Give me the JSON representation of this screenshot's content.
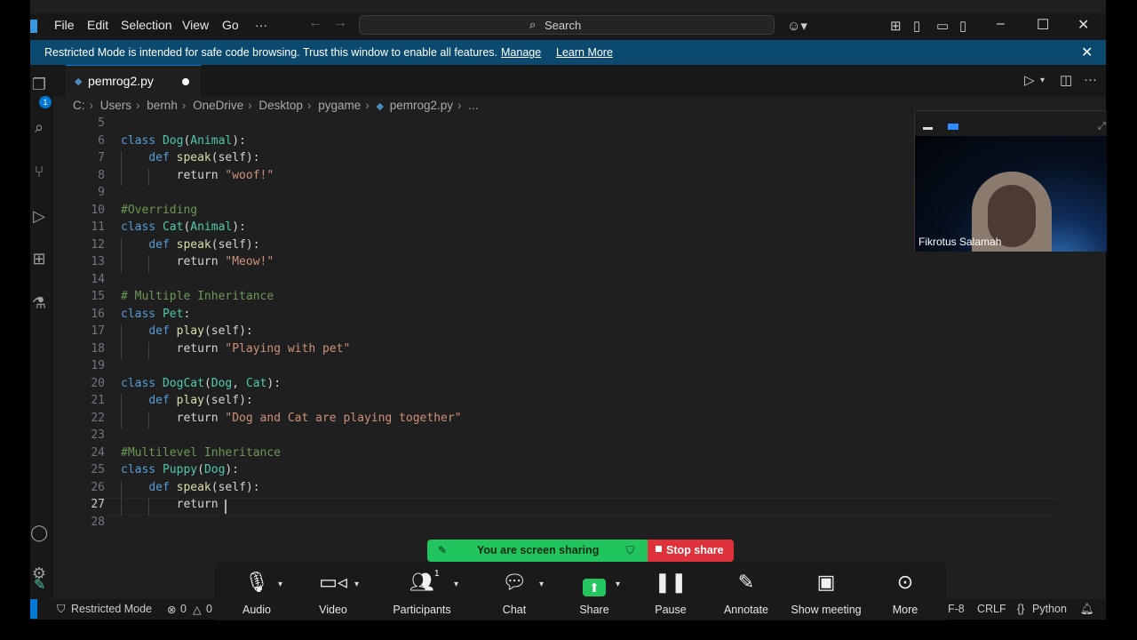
{
  "menu": [
    "File",
    "Edit",
    "Selection",
    "View",
    "Go",
    "···"
  ],
  "search": {
    "label": "Search"
  },
  "banner": {
    "message": "Restricted Mode is intended for safe code browsing. Trust this window to enable all features.",
    "manage": "Manage",
    "learn_more": "Learn More"
  },
  "activity": {
    "explorer_badge": "1"
  },
  "tab": {
    "filename": "pemrog2.py"
  },
  "breadcrumb": [
    "C:",
    "Users",
    "bernh",
    "OneDrive",
    "Desktop",
    "pygame",
    "pemrog2.py",
    "..."
  ],
  "code_lines": [
    {
      "n": "5"
    },
    {
      "n": "6",
      "t": [
        {
          "k": "kw",
          "v": "class "
        },
        {
          "k": "cls",
          "v": "Dog"
        },
        {
          "k": "txt",
          "v": "("
        },
        {
          "k": "cls",
          "v": "Animal"
        },
        {
          "k": "txt",
          "v": "):"
        }
      ]
    },
    {
      "n": "7",
      "t": [
        {
          "k": "txt",
          "v": "    "
        },
        {
          "k": "kw",
          "v": "def "
        },
        {
          "k": "fn",
          "v": "speak"
        },
        {
          "k": "txt",
          "v": "(self):"
        }
      ]
    },
    {
      "n": "8",
      "t": [
        {
          "k": "txt",
          "v": "        return "
        },
        {
          "k": "str",
          "v": "\"woof!\""
        }
      ]
    },
    {
      "n": "9"
    },
    {
      "n": "10",
      "t": [
        {
          "k": "cmt",
          "v": "#Overriding"
        }
      ]
    },
    {
      "n": "11",
      "t": [
        {
          "k": "kw",
          "v": "class "
        },
        {
          "k": "cls",
          "v": "Cat"
        },
        {
          "k": "txt",
          "v": "("
        },
        {
          "k": "cls",
          "v": "Animal"
        },
        {
          "k": "txt",
          "v": "):"
        }
      ]
    },
    {
      "n": "12",
      "t": [
        {
          "k": "txt",
          "v": "    "
        },
        {
          "k": "kw",
          "v": "def "
        },
        {
          "k": "fn",
          "v": "speak"
        },
        {
          "k": "txt",
          "v": "(self):"
        }
      ]
    },
    {
      "n": "13",
      "t": [
        {
          "k": "txt",
          "v": "        return "
        },
        {
          "k": "str",
          "v": "\"Meow!\""
        }
      ]
    },
    {
      "n": "14"
    },
    {
      "n": "15",
      "t": [
        {
          "k": "cmt",
          "v": "# Multiple Inheritance"
        }
      ]
    },
    {
      "n": "16",
      "t": [
        {
          "k": "kw",
          "v": "class "
        },
        {
          "k": "cls",
          "v": "Pet"
        },
        {
          "k": "txt",
          "v": ":"
        }
      ]
    },
    {
      "n": "17",
      "t": [
        {
          "k": "txt",
          "v": "    "
        },
        {
          "k": "kw",
          "v": "def "
        },
        {
          "k": "fn",
          "v": "play"
        },
        {
          "k": "txt",
          "v": "(self):"
        }
      ]
    },
    {
      "n": "18",
      "t": [
        {
          "k": "txt",
          "v": "        return "
        },
        {
          "k": "str",
          "v": "\"Playing with pet\""
        }
      ]
    },
    {
      "n": "19"
    },
    {
      "n": "20",
      "t": [
        {
          "k": "kw",
          "v": "class "
        },
        {
          "k": "cls",
          "v": "DogCat"
        },
        {
          "k": "txt",
          "v": "("
        },
        {
          "k": "cls",
          "v": "Dog"
        },
        {
          "k": "txt",
          "v": ", "
        },
        {
          "k": "cls",
          "v": "Cat"
        },
        {
          "k": "txt",
          "v": "):"
        }
      ]
    },
    {
      "n": "21",
      "t": [
        {
          "k": "txt",
          "v": "    "
        },
        {
          "k": "kw",
          "v": "def "
        },
        {
          "k": "fn",
          "v": "play"
        },
        {
          "k": "txt",
          "v": "(self):"
        }
      ]
    },
    {
      "n": "22",
      "t": [
        {
          "k": "txt",
          "v": "        return "
        },
        {
          "k": "str",
          "v": "\"Dog and Cat are playing together\""
        }
      ]
    },
    {
      "n": "23"
    },
    {
      "n": "24",
      "t": [
        {
          "k": "cmt",
          "v": "#Multilevel Inheritance"
        }
      ]
    },
    {
      "n": "25",
      "t": [
        {
          "k": "kw",
          "v": "class "
        },
        {
          "k": "cls",
          "v": "Puppy"
        },
        {
          "k": "txt",
          "v": "("
        },
        {
          "k": "cls",
          "v": "Dog"
        },
        {
          "k": "txt",
          "v": "):"
        }
      ]
    },
    {
      "n": "26",
      "t": [
        {
          "k": "txt",
          "v": "    "
        },
        {
          "k": "kw",
          "v": "def "
        },
        {
          "k": "fn",
          "v": "speak"
        },
        {
          "k": "txt",
          "v": "(self):"
        }
      ]
    },
    {
      "n": "27",
      "t": [
        {
          "k": "txt",
          "v": "        return "
        }
      ]
    },
    {
      "n": "28"
    }
  ],
  "current_line": "27",
  "video": {
    "participant_name": "Fikrotus Salamah"
  },
  "share_banner": {
    "status": "You are screen sharing",
    "stop": "Stop share"
  },
  "zoom_toolbar": {
    "audio": "Audio",
    "video": "Video",
    "participants": "Participants",
    "participants_count": "1",
    "chat": "Chat",
    "share": "Share",
    "pause": "Pause",
    "annotate": "Annotate",
    "show_meeting": "Show meeting",
    "more": "More"
  },
  "statusbar": {
    "restricted": "Restricted Mode",
    "errors": "0",
    "warnings": "0",
    "encoding": "F-8",
    "eol": "CRLF",
    "language": "Python"
  },
  "colors": {
    "accent": "#0078d4",
    "banner": "#0b4a6e",
    "share_green": "#21c55e",
    "stop_red": "#e0323a"
  }
}
